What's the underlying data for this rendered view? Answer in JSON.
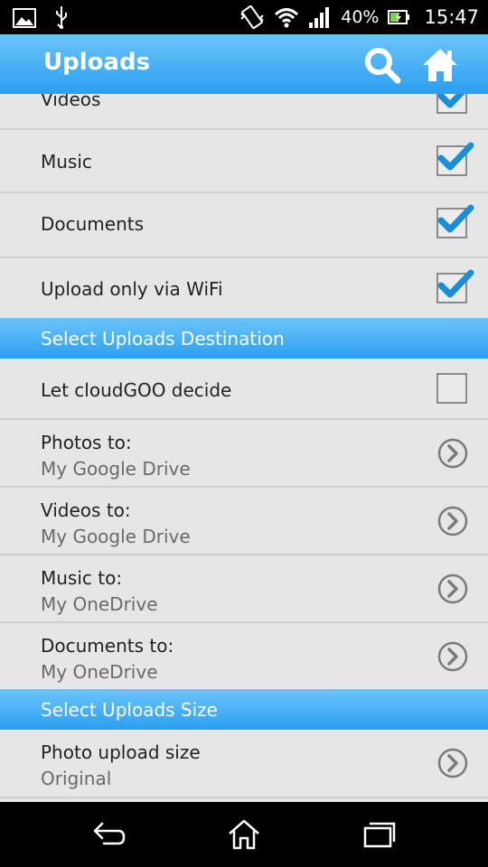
{
  "status": {
    "battery": "40%",
    "time": "15:47",
    "icons": [
      "image-icon",
      "usb-icon",
      "vibrate-icon",
      "wifi-icon",
      "signal-icon",
      "battery-icon"
    ]
  },
  "appbar": {
    "title": "Uploads",
    "icons": [
      "search-icon",
      "home-icon"
    ]
  },
  "uploads": {
    "videos": {
      "label": "Videos",
      "checked": true
    },
    "music": {
      "label": "Music",
      "checked": true
    },
    "documents": {
      "label": "Documents",
      "checked": true
    },
    "wifi_only": {
      "label": "Upload only via WiFi",
      "checked": true
    }
  },
  "destination": {
    "header": "Select Uploads Destination",
    "auto": {
      "label": "Let cloudGOO decide",
      "checked": false
    },
    "photos": {
      "label": "Photos to:",
      "value": "My Google Drive"
    },
    "videos": {
      "label": "Videos to:",
      "value": "My Google Drive"
    },
    "music": {
      "label": "Music to:",
      "value": "My OneDrive"
    },
    "documents": {
      "label": "Documents to:",
      "value": "My OneDrive"
    }
  },
  "size": {
    "header": "Select Uploads Size",
    "photo": {
      "label": "Photo upload size",
      "value": "Original"
    }
  },
  "navbar": {
    "icons": [
      "back-icon",
      "home-icon",
      "recents-icon"
    ]
  },
  "colors": {
    "accent": "#2b9ff0",
    "check": "#1a8fd9"
  }
}
